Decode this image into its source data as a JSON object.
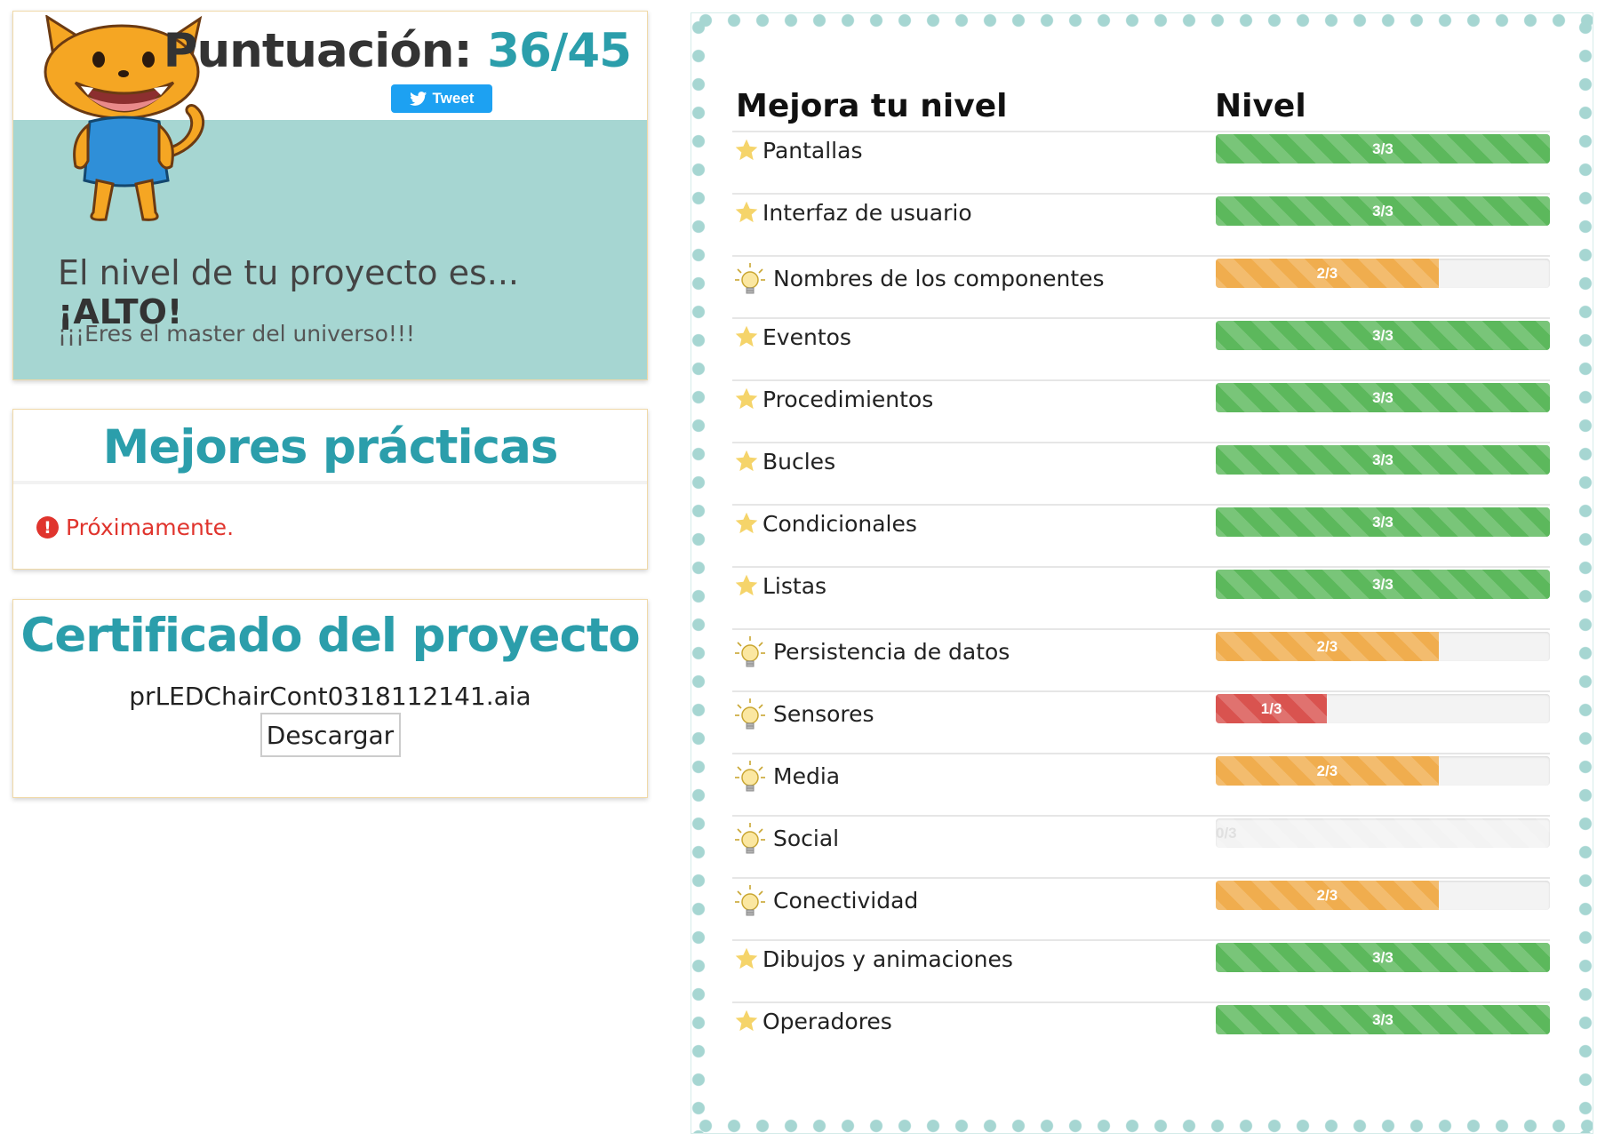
{
  "score": {
    "label": "Puntuación:",
    "value": "36/45",
    "tweet_label": "Tweet",
    "level_prefix": "El nivel de tu proyecto es...",
    "level_value": "¡ALTO!",
    "message": "¡¡¡Eres el master del universo!!!"
  },
  "best_practices": {
    "title": "Mejores prácticas",
    "message": "Próximamente."
  },
  "certificate": {
    "title": "Certificado del proyecto",
    "filename": "prLEDChairCont0318112141.aia",
    "download_label": "Descargar"
  },
  "levels": {
    "header_concept": "Mejora tu nivel",
    "header_level": "Nivel",
    "rows": [
      {
        "name": "Pantallas",
        "level": "3/3",
        "fraction": 1.0,
        "icon": "star-icon",
        "color": "#5cb85c"
      },
      {
        "name": "Interfaz de usuario",
        "level": "3/3",
        "fraction": 1.0,
        "icon": "star-icon",
        "color": "#5cb85c"
      },
      {
        "name": "Nombres de los componentes",
        "level": "2/3",
        "fraction": 0.667,
        "icon": "lightbulb-icon",
        "color": "#f0ad4e"
      },
      {
        "name": "Eventos",
        "level": "3/3",
        "fraction": 1.0,
        "icon": "star-icon",
        "color": "#5cb85c"
      },
      {
        "name": "Procedimientos",
        "level": "3/3",
        "fraction": 1.0,
        "icon": "star-icon",
        "color": "#5cb85c"
      },
      {
        "name": "Bucles",
        "level": "3/3",
        "fraction": 1.0,
        "icon": "star-icon",
        "color": "#5cb85c"
      },
      {
        "name": "Condicionales",
        "level": "3/3",
        "fraction": 1.0,
        "icon": "star-icon",
        "color": "#5cb85c"
      },
      {
        "name": "Listas",
        "level": "3/3",
        "fraction": 1.0,
        "icon": "star-icon",
        "color": "#5cb85c"
      },
      {
        "name": "Persistencia de datos",
        "level": "2/3",
        "fraction": 0.667,
        "icon": "lightbulb-icon",
        "color": "#f0ad4e"
      },
      {
        "name": "Sensores",
        "level": "1/3",
        "fraction": 0.333,
        "icon": "lightbulb-icon",
        "color": "#d9534f"
      },
      {
        "name": "Media",
        "level": "2/3",
        "fraction": 0.667,
        "icon": "lightbulb-icon",
        "color": "#f0ad4e"
      },
      {
        "name": "Social",
        "level": "0/3",
        "fraction": 0.0,
        "icon": "lightbulb-icon",
        "color": "#f3f3f3"
      },
      {
        "name": "Conectividad",
        "level": "2/3",
        "fraction": 0.667,
        "icon": "lightbulb-icon",
        "color": "#f0ad4e"
      },
      {
        "name": "Dibujos y animaciones",
        "level": "3/3",
        "fraction": 1.0,
        "icon": "star-icon",
        "color": "#5cb85c"
      },
      {
        "name": "Operadores",
        "level": "3/3",
        "fraction": 1.0,
        "icon": "star-icon",
        "color": "#5cb85c"
      }
    ]
  },
  "colors": {
    "accent": "#2b9eab",
    "panel_teal": "#a6d6d2",
    "alert_red": "#e0342d",
    "star": "#f5d46a"
  }
}
